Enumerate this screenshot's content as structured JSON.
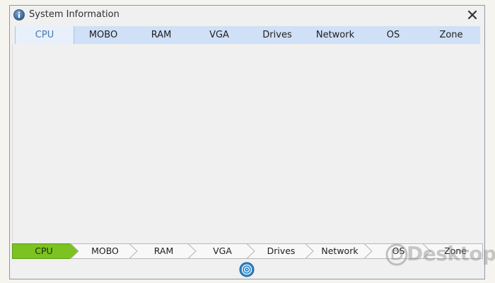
{
  "window": {
    "title": "System Information"
  },
  "top_tabs": [
    {
      "label": "CPU",
      "active": true
    },
    {
      "label": "MOBO",
      "active": false
    },
    {
      "label": "RAM",
      "active": false
    },
    {
      "label": "VGA",
      "active": false
    },
    {
      "label": "Drives",
      "active": false
    },
    {
      "label": "Network",
      "active": false
    },
    {
      "label": "OS",
      "active": false
    },
    {
      "label": "Zone",
      "active": false
    }
  ],
  "steps": [
    {
      "label": "CPU",
      "active": true
    },
    {
      "label": "MOBO",
      "active": false
    },
    {
      "label": "RAM",
      "active": false
    },
    {
      "label": "VGA",
      "active": false
    },
    {
      "label": "Drives",
      "active": false
    },
    {
      "label": "Network",
      "active": false
    },
    {
      "label": "OS",
      "active": false
    },
    {
      "label": "Zone",
      "active": false
    }
  ],
  "watermark": {
    "text": "Desktop"
  },
  "colors": {
    "tab_bar": "#cfe0f7",
    "active_step": "#7cc321",
    "step_bg": "#f8f8f8",
    "border": "#8c9aa8"
  },
  "icons": {
    "title": "info-icon",
    "close": "close-icon",
    "bottom": "fingerprint-icon"
  }
}
